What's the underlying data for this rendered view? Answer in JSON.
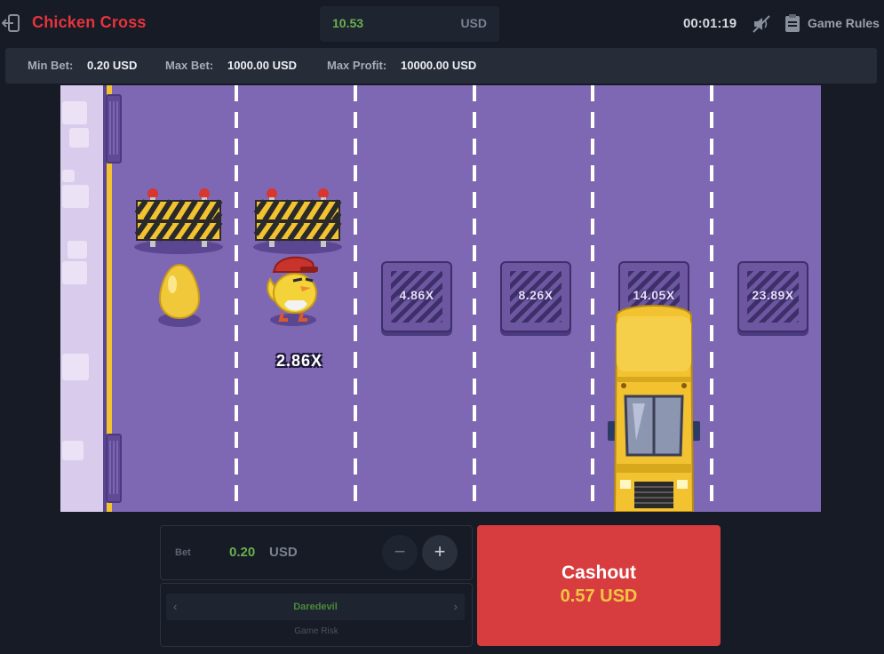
{
  "header": {
    "title": "Chicken Cross",
    "balance": "10.53",
    "currency": "USD",
    "timer": "00:01:19",
    "rules_label": "Game Rules",
    "icons": {
      "back": "exit-icon",
      "sound": "sound-muted-icon",
      "rules": "clipboard-icon"
    }
  },
  "limits": {
    "min_bet_label": "Min Bet:",
    "min_bet_value": "0.20 USD",
    "max_bet_label": "Max Bet:",
    "max_bet_value": "1000.00 USD",
    "max_profit_label": "Max Profit:",
    "max_profit_value": "10000.00 USD"
  },
  "game": {
    "current_multiplier": "2.86X",
    "lanes": [
      {
        "multiplier": "4.86X"
      },
      {
        "multiplier": "8.26X"
      },
      {
        "multiplier": "14.05X"
      },
      {
        "multiplier": "23.89X"
      }
    ],
    "colors": {
      "road": "#7e68b3",
      "sidewalk": "#d9cbec",
      "bus": "#f2c230",
      "barrier_stripe": "#f2c230"
    }
  },
  "controls": {
    "bet_label": "Bet",
    "bet_value": "0.20",
    "bet_currency": "USD",
    "minus": "−",
    "plus": "+",
    "risk_value": "Daredevil",
    "risk_label": "Game Risk",
    "cashout_label": "Cashout",
    "cashout_amount": "0.57 USD"
  }
}
